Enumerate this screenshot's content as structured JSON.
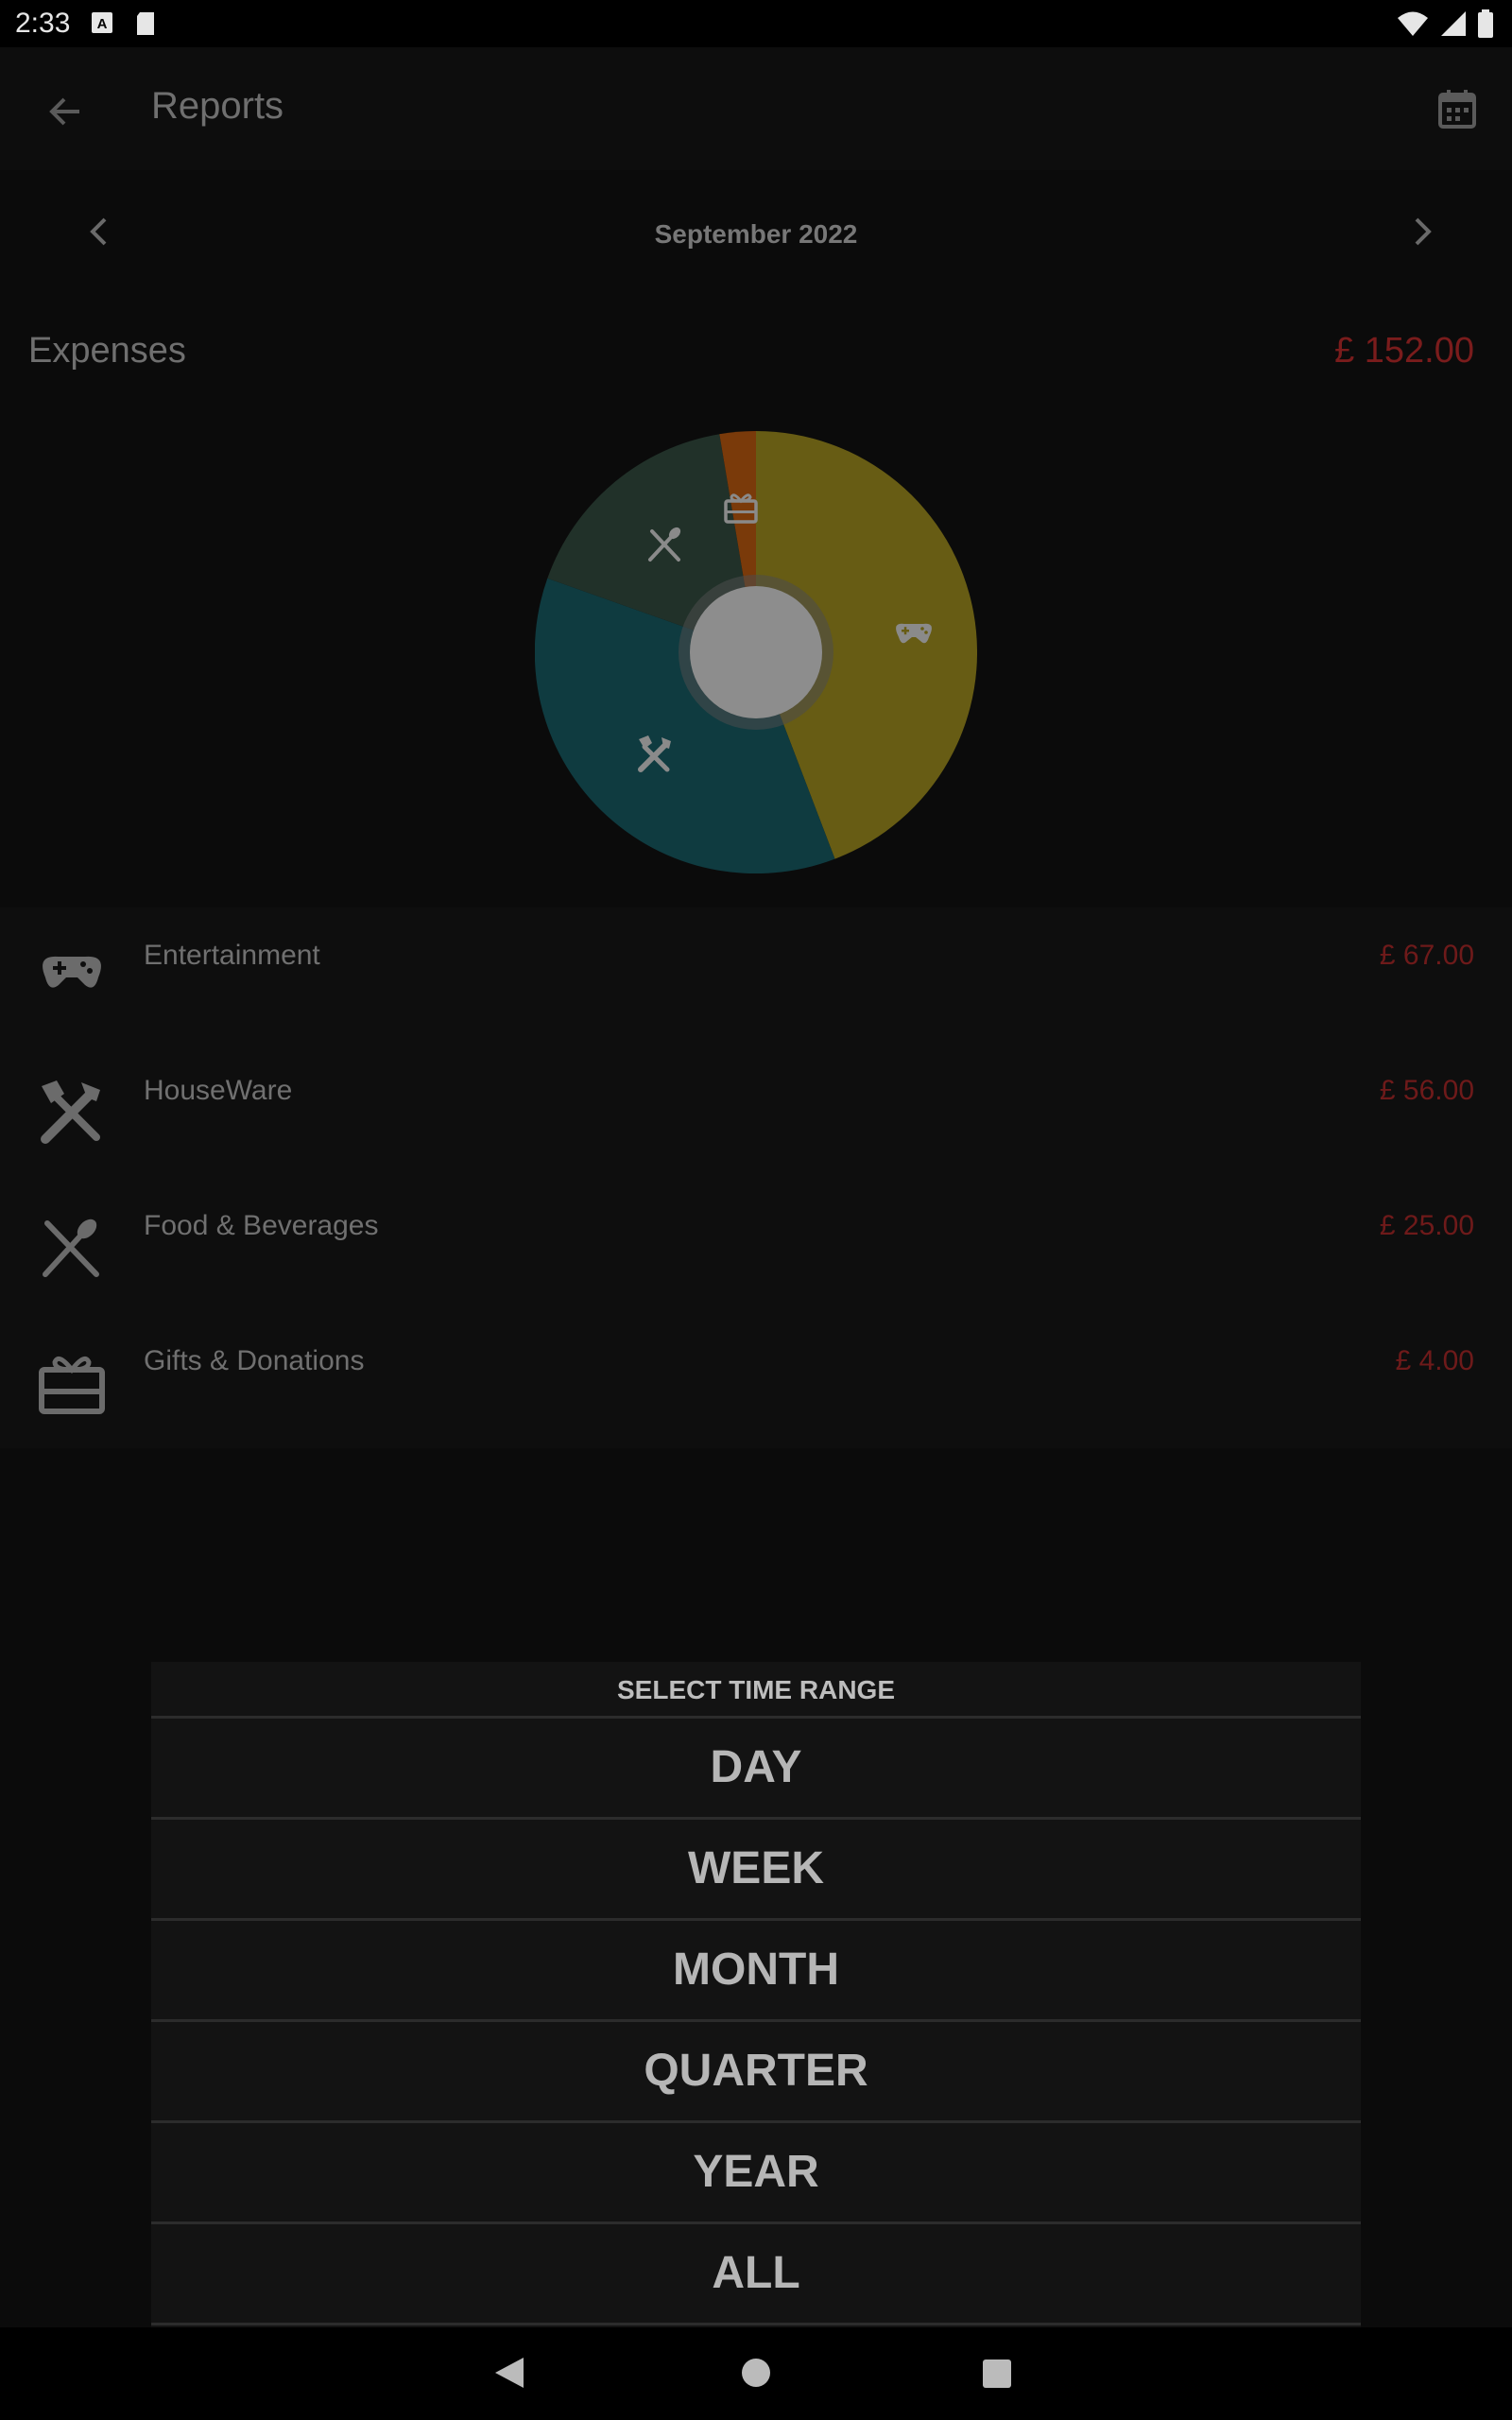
{
  "status": {
    "time": "2:33"
  },
  "appbar": {
    "title": "Reports"
  },
  "period": {
    "label": "September 2022"
  },
  "summary": {
    "label": "Expenses",
    "total": "£ 152.00"
  },
  "categories": [
    {
      "label": "Entertainment",
      "amount": "£ 67.00",
      "icon": "gamepad-icon"
    },
    {
      "label": "HouseWare",
      "amount": "£ 56.00",
      "icon": "tools-icon"
    },
    {
      "label": "Food & Beverages",
      "amount": "£ 25.00",
      "icon": "utensils-icon"
    },
    {
      "label": "Gifts & Donations",
      "amount": "£ 4.00",
      "icon": "gift-card-icon"
    }
  ],
  "dialog": {
    "title": "SELECT TIME RANGE",
    "options": [
      "DAY",
      "WEEK",
      "MONTH",
      "QUARTER",
      "YEAR",
      "ALL"
    ]
  },
  "colors": {
    "entertainment": "#675c14",
    "houseware": "#0f3b40",
    "food": "#213129",
    "gifts": "#7a3a0a",
    "amount_red": "#7a1c1c"
  }
}
